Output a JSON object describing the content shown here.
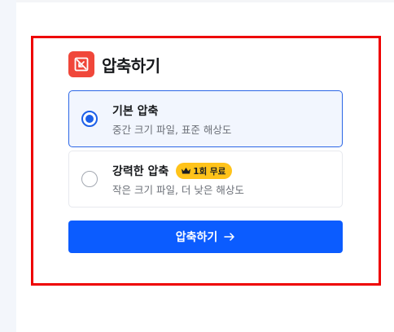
{
  "header": {
    "title": "압축하기",
    "icon": "compress-icon"
  },
  "options": [
    {
      "title": "기본 압축",
      "description": "중간 크기 파일, 표준 해상도",
      "selected": true
    },
    {
      "title": "강력한 압축",
      "description": "작은 크기 파일, 더 낮은 해상도",
      "selected": false,
      "badge": {
        "icon": "crown-icon",
        "label": "1회 무료"
      }
    }
  ],
  "action": {
    "label": "압축하기",
    "icon": "arrow-right-icon"
  },
  "colors": {
    "primary": "#0b5cff",
    "selected_border": "#2b66e6",
    "badge": "#ffc31a",
    "header_icon": "#f0473a",
    "highlight": "#ee0000"
  }
}
